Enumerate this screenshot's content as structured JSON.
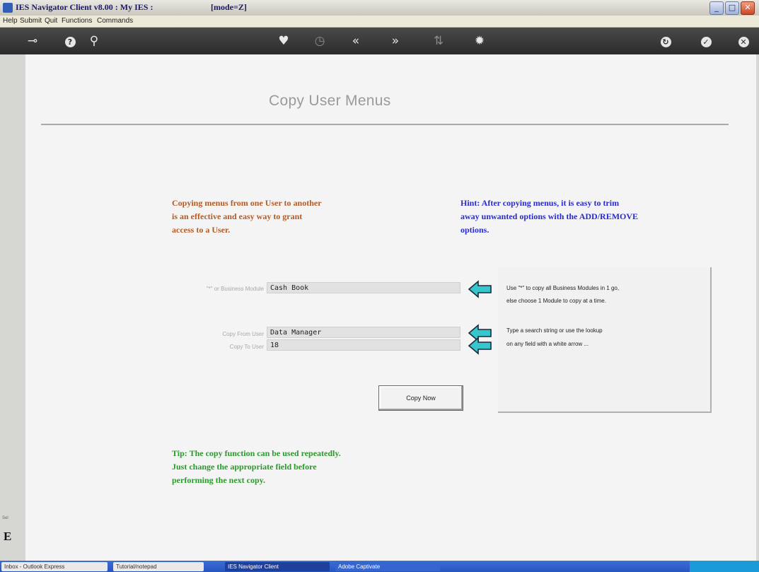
{
  "window": {
    "title": "IES Navigator Client v8.00 : My IES :",
    "mode": "[mode=Z]",
    "buttons": {
      "minimize": "_",
      "maximize": "□",
      "close": "✕"
    }
  },
  "menubar": [
    "Help",
    "Submit",
    "Quit",
    "Functions",
    "Commands"
  ],
  "toolbar": {
    "key_icon": "⊸",
    "help_icon": "?",
    "search_icon": "⚲",
    "favorite_icon": "♥",
    "clock_icon": "◷",
    "back_icon": "«",
    "forward_icon": "»",
    "sort_icon": "⇅",
    "stop_icon": "✹",
    "refresh_icon": "↻",
    "ok_icon": "✓",
    "cancel_icon": "✕"
  },
  "page": {
    "title": "Copy User Menus",
    "intro": [
      "Copying menus from one User to another",
      "is an effective and easy way to grant",
      "access to a User."
    ],
    "hint": [
      "Hint: After copying menus, it is easy to trim",
      "away unwanted options with the ADD/REMOVE",
      "options."
    ],
    "tip": [
      "Tip: The copy function can be used repeatedly.",
      "Just change the appropriate field before",
      "performing the next copy."
    ]
  },
  "form": {
    "module_label": "\"*\" or Business Module",
    "module_value": "Cash Book",
    "from_label": "Copy From User",
    "from_value": "Data Manager",
    "to_label": "Copy To User",
    "to_value": "18",
    "copy_button": "Copy Now"
  },
  "info": {
    "line1": "Use \"*\" to copy all Business Modules in 1 go,",
    "line2": "else choose 1 Module to copy at a time.",
    "line3": "Type a search string or use the lookup",
    "line4": "on any field with a white arrow ..."
  },
  "sidebar": {
    "text": "Sel",
    "glyph": "E"
  },
  "taskbar": {
    "items": [
      "Inbox - Outlook Express",
      "Tutorial/notepad",
      "IES Navigator Client",
      "Adobe Captivate"
    ]
  },
  "colors": {
    "intro": "#b65a22",
    "hint": "#2a2ad2",
    "tip": "#2a9a2a",
    "arrow": "#36c6cc",
    "toolbar": "#333333"
  }
}
